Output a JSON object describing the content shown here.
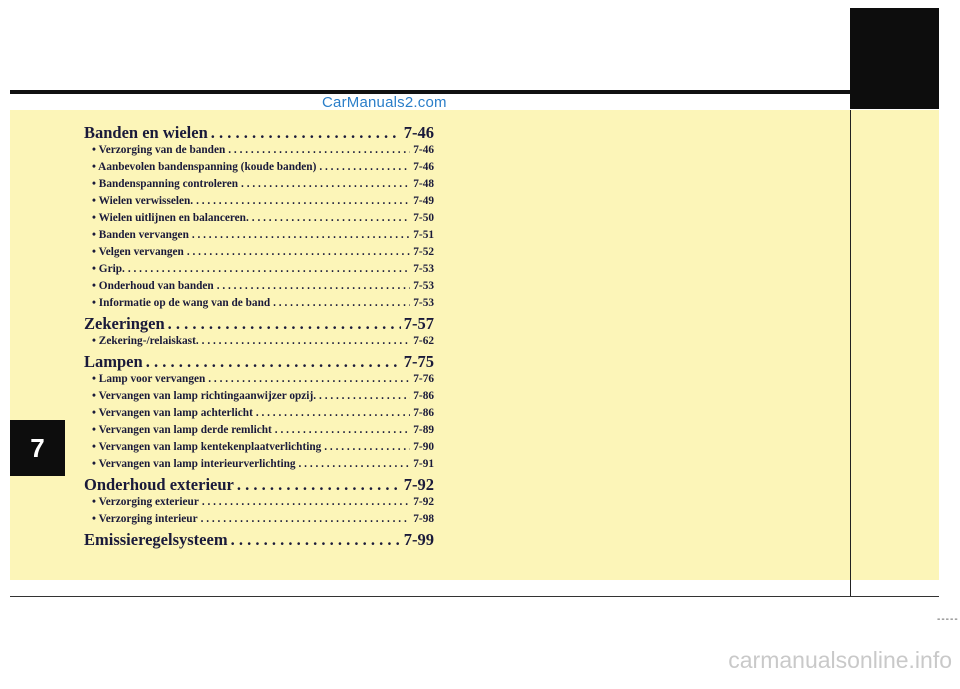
{
  "watermark_top": "CarManuals2.com",
  "watermark_bottom": "carmanualsonline.info",
  "chapter_number": "7",
  "bottom_dashes": "-----",
  "toc": {
    "sections": [
      {
        "title": "Banden en wielen",
        "page": "7-46",
        "items": [
          {
            "title": "• Verzorging van de banden",
            "page": "7-46"
          },
          {
            "title": "• Aanbevolen bandenspanning (koude banden)",
            "page": "7-46"
          },
          {
            "title": "• Bandenspanning controleren",
            "page": "7-48"
          },
          {
            "title": "• Wielen verwisselen.",
            "page": "7-49"
          },
          {
            "title": "• Wielen uitlijnen en balanceren.",
            "page": "7-50"
          },
          {
            "title": "• Banden vervangen",
            "page": "7-51"
          },
          {
            "title": "• Velgen vervangen",
            "page": "7-52"
          },
          {
            "title": "• Grip.",
            "page": "7-53"
          },
          {
            "title": "• Onderhoud van banden",
            "page": "7-53"
          },
          {
            "title": "• Informatie op de wang van de band",
            "page": "7-53"
          }
        ]
      },
      {
        "title": "Zekeringen",
        "page": "7-57",
        "items": [
          {
            "title": "• Zekering-/relaiskast.",
            "page": "7-62"
          }
        ]
      },
      {
        "title": "Lampen",
        "page": "7-75",
        "items": [
          {
            "title": "• Lamp voor vervangen",
            "page": "7-76"
          },
          {
            "title": "• Vervangen van lamp richtingaanwijzer opzij.",
            "page": "7-86"
          },
          {
            "title": "• Vervangen van lamp achterlicht",
            "page": "7-86"
          },
          {
            "title": "• Vervangen van lamp derde remlicht",
            "page": "7-89"
          },
          {
            "title": "• Vervangen van lamp kentekenplaatverlichting",
            "page": "7-90"
          },
          {
            "title": "• Vervangen van lamp interieurverlichting",
            "page": "7-91"
          }
        ]
      },
      {
        "title": "Onderhoud exterieur",
        "page": "7-92",
        "items": [
          {
            "title": "• Verzorging exterieur",
            "page": "7-92"
          },
          {
            "title": "• Verzorging interieur",
            "page": "7-98"
          }
        ]
      },
      {
        "title": "Emissieregelsysteem",
        "page": "7-99",
        "items": []
      }
    ]
  }
}
